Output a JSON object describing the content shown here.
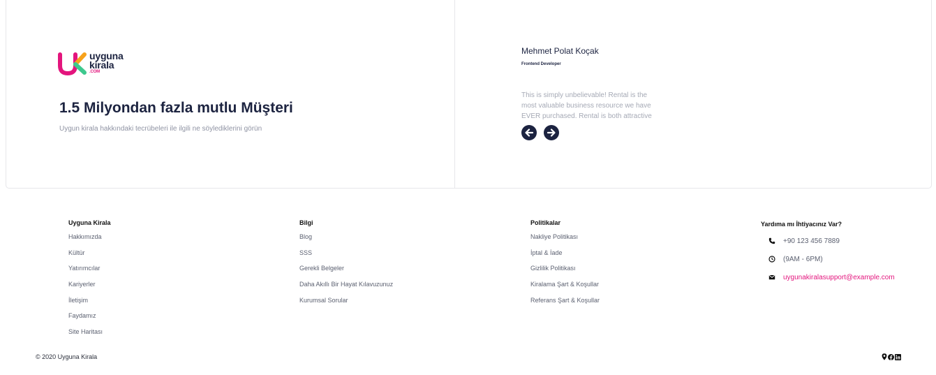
{
  "brand": {
    "logo_line1": "uyguna",
    "logo_line2": "kirala",
    "logo_suffix": ".COM",
    "colors": {
      "pink": "#e3157d",
      "orange": "#f7a21b",
      "green": "#3ec98e",
      "navy": "#1c2340"
    }
  },
  "testimonials": {
    "headline": "1.5 Milyondan fazla mutlu Müşteri",
    "subline": "Uygun kirala hakkındaki tecrübeleri ile ilgili ne söylediklerini görün",
    "current": {
      "name": "Mehmet Polat Koçak",
      "role": "Frontend Developer",
      "quote": "This is simply unbelievable! Rental is the most valuable business resource we have EVER purchased. Rental is both attractive"
    },
    "prev_icon": "arrow-left-circle-icon",
    "next_icon": "arrow-right-circle-icon"
  },
  "footer": {
    "columns": [
      {
        "title": "Uyguna Kirala",
        "links": [
          "Hakkımızda",
          "Kültür",
          "Yatırımcılar",
          "Kariyerler",
          "İletişim",
          "Faydamız",
          "Site Haritası"
        ]
      },
      {
        "title": "Bilgi",
        "links": [
          "Blog",
          "SSS",
          "Gerekli Belgeler",
          "Daha Akıllı Bir Hayat Kılavuzunuz",
          "Kurumsal Sorular"
        ]
      },
      {
        "title": "Politikalar",
        "links": [
          "Nakliye Politikası",
          "İptal & İade",
          "Gizlilik Politikası",
          "Kiralama Şart & Koşullar",
          "Referans Şart & Koşullar"
        ]
      }
    ],
    "help": {
      "title": "Yardıma mı İhtiyacınız Var?",
      "phone": "+90 123 456 7889",
      "hours": "(9AM - 6PM)",
      "email": "uygunakiralasupport@example.com"
    },
    "copyright": "© 2020 Uyguna Kirala",
    "socials": [
      "location-icon",
      "facebook-icon",
      "linkedin-icon"
    ]
  }
}
